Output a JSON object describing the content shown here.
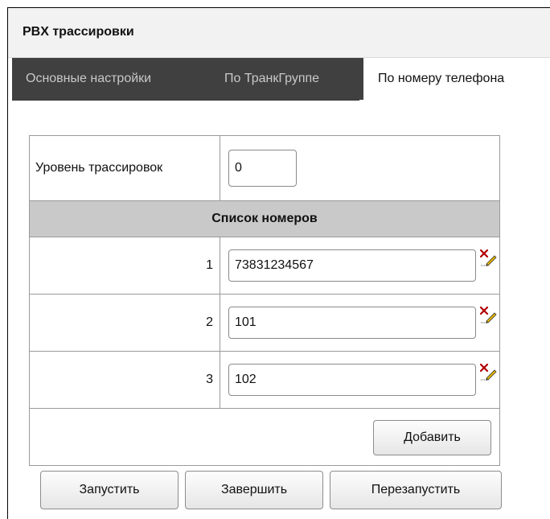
{
  "panel": {
    "title": "PBX трассировки"
  },
  "tabs": [
    {
      "label": "Основные настройки",
      "active": false
    },
    {
      "label": "По ТранкГруппе",
      "active": false
    },
    {
      "label": "По номеру телефона",
      "active": true
    }
  ],
  "trace_level": {
    "label": "Уровень трассировок",
    "value": "0"
  },
  "numbers_list": {
    "header": "Список номеров",
    "rows": [
      {
        "index": "1",
        "value": "73831234567"
      },
      {
        "index": "2",
        "value": "101"
      },
      {
        "index": "3",
        "value": "102"
      }
    ],
    "add_label": "Добавить"
  },
  "actions": {
    "start_label": "Запустить",
    "stop_label": "Завершить",
    "restart_label": "Перезапустить"
  },
  "colors": {
    "tab_bar": "#404040",
    "header_row": "#c9c9c9",
    "delete_icon": "#b00000"
  }
}
